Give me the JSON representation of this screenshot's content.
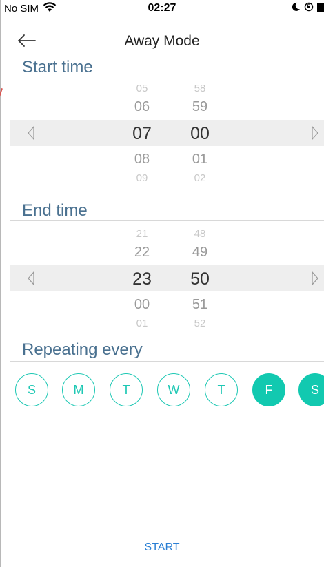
{
  "status_bar": {
    "carrier": "No SIM",
    "time": "02:27",
    "icons": [
      "wifi-icon",
      "moon-icon",
      "orientation-lock-icon",
      "battery-icon"
    ]
  },
  "nav": {
    "title": "Away Mode",
    "back_icon": "back-arrow-icon"
  },
  "start_time": {
    "label": "Start time",
    "hours": [
      "05",
      "06",
      "07",
      "08",
      "09"
    ],
    "minutes": [
      "58",
      "59",
      "00",
      "01",
      "02"
    ],
    "selected_hour": "07",
    "selected_minute": "00"
  },
  "end_time": {
    "label": "End time",
    "hours": [
      "21",
      "22",
      "23",
      "00",
      "01"
    ],
    "minutes": [
      "48",
      "49",
      "50",
      "51",
      "52"
    ],
    "selected_hour": "23",
    "selected_minute": "50"
  },
  "repeat": {
    "label": "Repeating every",
    "days": [
      {
        "label": "S",
        "selected": false
      },
      {
        "label": "M",
        "selected": false
      },
      {
        "label": "T",
        "selected": false
      },
      {
        "label": "W",
        "selected": false
      },
      {
        "label": "T",
        "selected": false
      },
      {
        "label": "F",
        "selected": true
      },
      {
        "label": "S",
        "selected": true
      }
    ]
  },
  "start_button": "START",
  "colors": {
    "accent": "#12c9b0",
    "section_title": "#4a7190",
    "link": "#2a7fd4"
  }
}
